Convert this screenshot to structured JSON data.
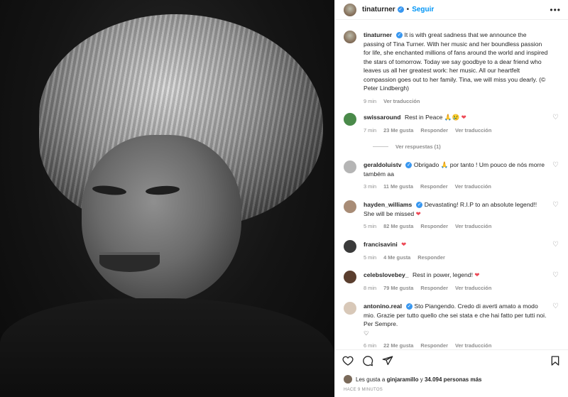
{
  "post": {
    "username": "tinaturner",
    "follow_label": "Seguir",
    "separator": "•",
    "verified_glyph": "✓",
    "caption": "It is with great sadness that we announce the passing of Tina Turner. With her music and her boundless passion for life, she enchanted millions of fans around the world and inspired the stars of tomorrow. Today we say goodbye to a dear friend who leaves us all her greatest work: her music. All our heartfelt compassion goes out to her family. Tina, we will miss you dearly. (© Peter Lindbergh)",
    "caption_time": "9 min",
    "caption_translate": "Ver traducción"
  },
  "comments": [
    {
      "user": "swissaround",
      "text": "Rest in Peace 🙏😢",
      "heart": "❤",
      "time": "7 min",
      "likes": "23 Me gusta",
      "reply": "Responder",
      "translate": "Ver traducción",
      "avatar_color": "#4a8a4a"
    },
    {
      "user": "geraldoluistv",
      "verified": true,
      "text": "Obrigado 🙏 por tanto ! Um pouco de nós morre também aa",
      "time": "3 min",
      "likes": "11 Me gusta",
      "reply": "Responder",
      "translate": "Ver traducción",
      "avatar_color": "#b5b5b5"
    },
    {
      "user": "hayden_williams",
      "verified": true,
      "text": "Devastating! R.I.P to an absolute legend!! She will be missed",
      "heart": "❤",
      "time": "5 min",
      "likes": "82 Me gusta",
      "reply": "Responder",
      "translate": "Ver traducción",
      "avatar_color": "#a88c76"
    },
    {
      "user": "francisavini",
      "text": "",
      "heart": "❤",
      "time": "5 min",
      "likes": "4 Me gusta",
      "reply": "Responder",
      "avatar_color": "#3a3a3a"
    },
    {
      "user": "celebslovebey_",
      "text": "Rest in power, legend!",
      "heart": "❤",
      "time": "8 min",
      "likes": "79 Me gusta",
      "reply": "Responder",
      "translate": "Ver traducción",
      "avatar_color": "#5a3e2e"
    },
    {
      "user": "antonino.real",
      "verified": true,
      "text": "Sto Piangendo. Credo di averti amato a modo mio. Grazie per tutto quello che sei stata e che hai fatto per tutti noi. Per Sempre.",
      "extra": "♡",
      "time": "6 min",
      "likes": "22 Me gusta",
      "reply": "Responder",
      "translate": "Ver traducción",
      "avatar_color": "#d8c8b8"
    }
  ],
  "view_replies": "Ver respuestas (1)",
  "likes_summary": {
    "prefix": "Les gusta a",
    "user": "ginjaramillo",
    "connector": "y",
    "count": "34.094 personas más"
  },
  "timestamp": "HACE 9 MINUTOS",
  "icons": [
    "heart-icon",
    "comment-icon",
    "share-icon",
    "bookmark-icon",
    "more-options-icon"
  ]
}
